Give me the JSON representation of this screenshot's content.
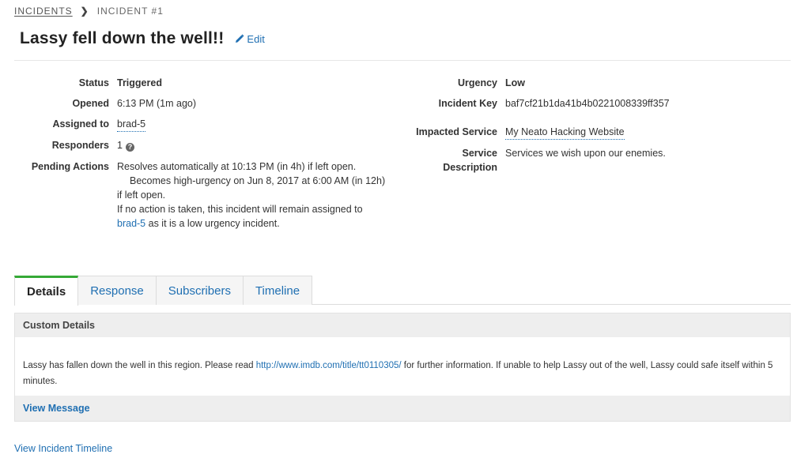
{
  "breadcrumb": {
    "root": "INCIDENTS",
    "current": "INCIDENT #1"
  },
  "title": "Lassy fell down the well!!",
  "edit_label": "Edit",
  "fields_left": {
    "status": {
      "label": "Status",
      "value": "Triggered"
    },
    "opened": {
      "label": "Opened",
      "value": "6:13 PM (1m ago)"
    },
    "assigned": {
      "label": "Assigned to",
      "value": "brad-5"
    },
    "responders": {
      "label": "Responders",
      "value": "1"
    },
    "pending": {
      "label": "Pending Actions",
      "line1": "Resolves automatically at 10:13 PM (in 4h) if left open.",
      "line2": "Becomes high-urgency on Jun 8, 2017 at 6:00 AM (in 12h)",
      "line3": "if left open.",
      "line4": "If no action is taken, this incident will remain assigned to",
      "line5_link": "brad-5",
      "line5_rest": " as it is a low urgency incident."
    }
  },
  "fields_right": {
    "urgency": {
      "label": "Urgency",
      "value": "Low"
    },
    "key": {
      "label": "Incident Key",
      "value": "baf7cf21b1da41b4b0221008339ff357"
    },
    "service": {
      "label": "Impacted Service",
      "value": "My Neato Hacking Website"
    },
    "description": {
      "label_line1": "Service",
      "label_line2": "Description",
      "value": "Services we wish upon our enemies."
    }
  },
  "tabs": [
    "Details",
    "Response",
    "Subscribers",
    "Timeline"
  ],
  "panel": {
    "header": "Custom Details",
    "body_before": "Lassy has fallen down the well in this region. Please read ",
    "body_link": "http://www.imdb.com/title/tt0110305/",
    "body_after": " for further information. If unable to help Lassy out of the well, Lassy could safe itself within 5 minutes.",
    "footer": "View Message"
  },
  "timeline_link": "View Incident Timeline",
  "colors": {
    "accent": "#1f6fb2",
    "triggered": "#a0201c",
    "active_tab": "#35a936"
  },
  "icons": {
    "separator": "chevron-right-icon",
    "edit": "pencil-icon",
    "help": "question-circle-icon"
  }
}
